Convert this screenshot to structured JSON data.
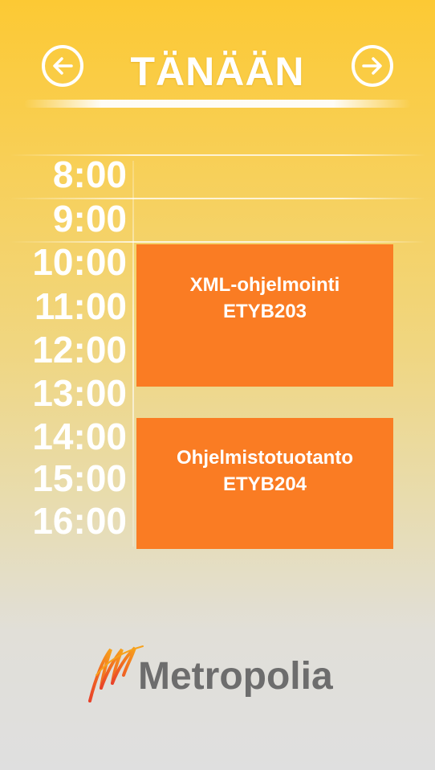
{
  "header": {
    "title": "TÄNÄÄN",
    "prev_icon": "arrow-left-circle-icon",
    "next_icon": "arrow-right-circle-icon"
  },
  "schedule": {
    "hours": [
      "8:00",
      "9:00",
      "10:00",
      "11:00",
      "12:00",
      "13:00",
      "14:00",
      "15:00",
      "16:00"
    ],
    "events": [
      {
        "name": "XML-ohjelmointi",
        "code": "ETYB203",
        "start": "10:00",
        "end": "13:00"
      },
      {
        "name": "Ohjelmistotuotanto",
        "code": "ETYB204",
        "start": "14:00",
        "end": "17:00"
      }
    ]
  },
  "logo": {
    "text": "Metropolia",
    "icon": "metropolia-logo-icon"
  },
  "colors": {
    "event": "#fa7c23",
    "background_top": "#fcc934",
    "background_bottom": "#dfdfdf",
    "logo_text": "#6d6d6d"
  }
}
